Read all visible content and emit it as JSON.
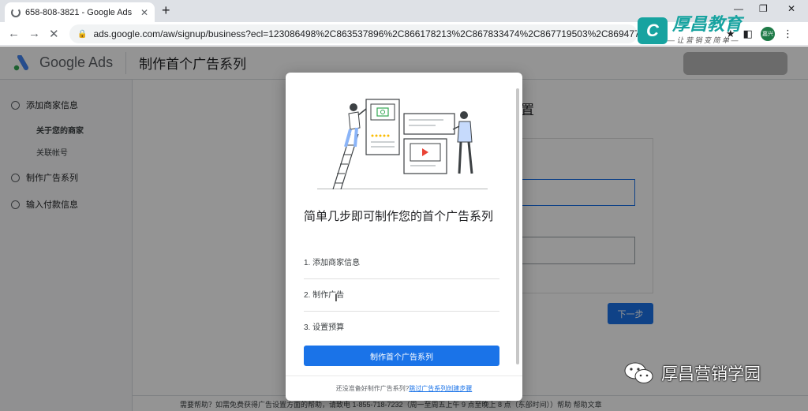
{
  "browser": {
    "tab_title": "658-808-3821 - Google Ads",
    "new_tab": "+",
    "url": "ads.google.com/aw/signup/business?ecl=123086498%2C863537896%2C866178213%2C867833474%2C867719503%2C869477...",
    "back": "←",
    "forward": "→",
    "reload": "✕",
    "avatar_text": "嘉兴"
  },
  "watermark": {
    "brand": "厚昌教育",
    "slogan": "— 让 营 销 变 简 单 —"
  },
  "app": {
    "name": "Google Ads",
    "title": "制作首个广告系列"
  },
  "sidebar": {
    "steps": [
      {
        "label": "添加商家信息"
      },
      {
        "label": "制作广告系列"
      },
      {
        "label": "输入付款信息"
      }
    ],
    "substeps": [
      {
        "label": "关于您的商家"
      },
      {
        "label": "关联帐号"
      }
    ]
  },
  "background": {
    "heading_fragment": "置",
    "next_button": "下一步",
    "footer": "需要帮助？如需免费获得广告设置方面的帮助，请致电 1-855-718-7232（周一至周五上午 9 点至晚上 8 点（东部时间））帮助 帮助文章"
  },
  "modal": {
    "title": "简单几步即可制作您的首个广告系列",
    "items": [
      "1. 添加商家信息",
      "2. 制作广告",
      "3. 设置预算"
    ],
    "cta": "制作首个广告系列",
    "footer_prefix": "还没准备好制作广告系列?",
    "footer_link": "跳过广告系列创建步骤"
  },
  "wechat": {
    "label": "厚昌营销学园"
  },
  "colors": {
    "primary": "#1a73e8",
    "brand_teal": "#17a3a0",
    "overlay": "rgba(0,0,0,0.42)"
  }
}
